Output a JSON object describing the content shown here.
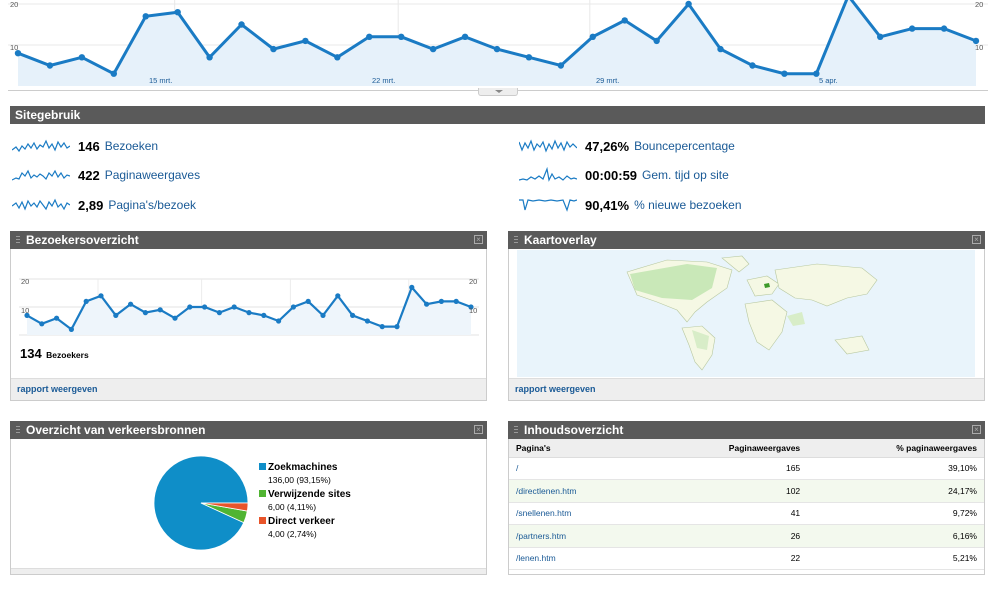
{
  "top_chart": {
    "y_ticks": [
      "20",
      "10"
    ],
    "date_labels": [
      "15 mrt.",
      "22 mrt.",
      "29 mrt.",
      "5 apr."
    ],
    "color": "#1a7bc4"
  },
  "sitegebruik": {
    "title": "Sitegebruik",
    "metrics": [
      {
        "value": "146",
        "label": "Bezoeken"
      },
      {
        "value": "422",
        "label": "Paginaweergaves"
      },
      {
        "value": "2,89",
        "label": "Pagina's/bezoek"
      },
      {
        "value": "47,26%",
        "label": "Bouncepercentage"
      },
      {
        "value": "00:00:59",
        "label": "Gem. tijd op site"
      },
      {
        "value": "90,41%",
        "label": "% nieuwe bezoeken"
      }
    ]
  },
  "bezoekers": {
    "title": "Bezoekersoverzicht",
    "y_ticks": [
      "20",
      "10"
    ],
    "total_value": "134",
    "total_label": "Bezoekers",
    "footer_link": "rapport weergeven"
  },
  "kaart": {
    "title": "Kaartoverlay",
    "footer_link": "rapport weergeven"
  },
  "verkeer": {
    "title": "Overzicht van verkeersbronnen",
    "legend": [
      {
        "name": "Zoekmachines",
        "detail": "136,00 (93,15%)",
        "color": "#0f8ec8"
      },
      {
        "name": "Verwijzende sites",
        "detail": "6,00 (4,11%)",
        "color": "#50b432"
      },
      {
        "name": "Direct verkeer",
        "detail": "4,00 (2,74%)",
        "color": "#e8542a"
      }
    ]
  },
  "inhoud": {
    "title": "Inhoudsoverzicht",
    "columns": [
      "Pagina's",
      "Paginaweergaves",
      "% paginaweergaves"
    ],
    "rows": [
      {
        "page": "/",
        "views": "165",
        "pct": "39,10%"
      },
      {
        "page": "/directlenen.htm",
        "views": "102",
        "pct": "24,17%"
      },
      {
        "page": "/snellenen.htm",
        "views": "41",
        "pct": "9,72%"
      },
      {
        "page": "/partners.htm",
        "views": "26",
        "pct": "6,16%"
      },
      {
        "page": "/lenen.htm",
        "views": "22",
        "pct": "5,21%"
      }
    ]
  },
  "chart_data": [
    {
      "type": "area",
      "y": [
        8,
        5,
        7,
        3,
        17,
        18,
        7,
        15,
        9,
        11,
        7,
        12,
        12,
        9,
        12,
        9,
        7,
        5,
        12,
        16,
        11,
        20,
        9,
        5,
        3,
        3,
        22,
        12,
        14,
        14,
        11
      ],
      "x": [
        "",
        "",
        "",
        "",
        "",
        "15 mrt.",
        "",
        "",
        "",
        "",
        "",
        "22 mrt.",
        "",
        "",
        "",
        "",
        "",
        "",
        "29 mrt.",
        "",
        "",
        "",
        "",
        "",
        "",
        "",
        "5 apr.",
        "",
        "",
        "",
        ""
      ],
      "ylim": [
        0,
        20
      ]
    },
    {
      "type": "line",
      "y": [
        7,
        4,
        6,
        2,
        12,
        14,
        7,
        11,
        8,
        9,
        6,
        10,
        10,
        8,
        10,
        8,
        7,
        5,
        10,
        12,
        7,
        14,
        7,
        5,
        3,
        3,
        17,
        11,
        12,
        12,
        10
      ],
      "ylim": [
        0,
        20
      ]
    },
    {
      "type": "pie",
      "categories": [
        "Zoekmachines",
        "Verwijzende sites",
        "Direct verkeer"
      ],
      "values": [
        136,
        6,
        4
      ]
    }
  ]
}
